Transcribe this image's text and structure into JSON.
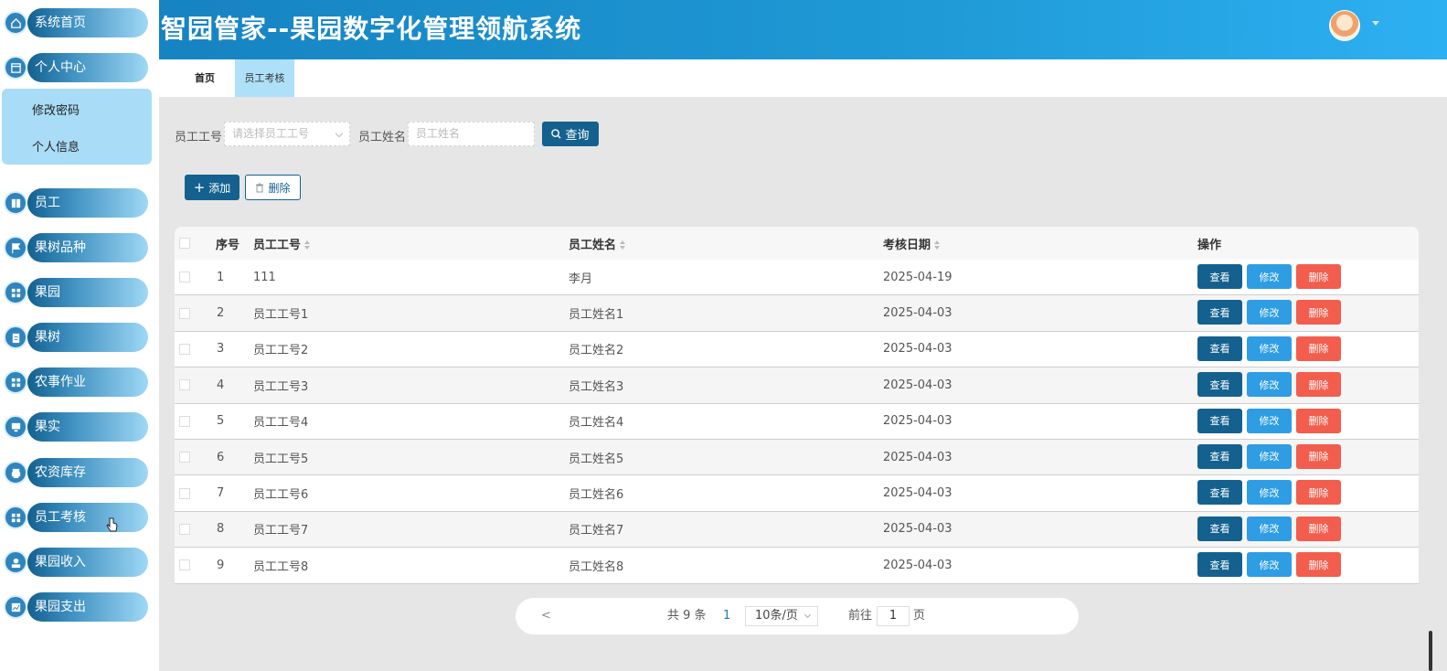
{
  "header": {
    "title": "智园管家--果园数字化管理领航系统"
  },
  "sidebar": {
    "items": [
      {
        "label": "系统首页",
        "icon": "home-icon"
      },
      {
        "label": "个人中心",
        "icon": "window-icon"
      },
      {
        "label": "员工",
        "icon": "book-icon"
      },
      {
        "label": "果树品种",
        "icon": "flag-icon"
      },
      {
        "label": "果园",
        "icon": "grid-icon"
      },
      {
        "label": "果树",
        "icon": "clipboard-icon"
      },
      {
        "label": "农事作业",
        "icon": "grid-icon"
      },
      {
        "label": "果实",
        "icon": "monitor-icon"
      },
      {
        "label": "农资库存",
        "icon": "printer-icon"
      },
      {
        "label": "员工考核",
        "icon": "grid-icon"
      },
      {
        "label": "果园收入",
        "icon": "user-icon"
      },
      {
        "label": "果园支出",
        "icon": "chart-icon"
      }
    ],
    "submenu": [
      "修改密码",
      "个人信息"
    ]
  },
  "tabs": [
    {
      "label": "首页"
    },
    {
      "label": "员工考核"
    }
  ],
  "search": {
    "id_label": "员工工号",
    "id_placeholder": "请选择员工工号",
    "name_label": "员工姓名",
    "name_placeholder": "员工姓名",
    "query_button": "查询"
  },
  "actions": {
    "add": "添加",
    "delete": "删除"
  },
  "table": {
    "headers": [
      "序号",
      "员工工号",
      "员工姓名",
      "考核日期",
      "操作"
    ],
    "op_labels": {
      "view": "查看",
      "edit": "修改",
      "delete": "删除"
    },
    "rows": [
      {
        "no": "1",
        "emp_id": "111",
        "emp_name": "李月",
        "date": "2025-04-19"
      },
      {
        "no": "2",
        "emp_id": "员工工号1",
        "emp_name": "员工姓名1",
        "date": "2025-04-03"
      },
      {
        "no": "3",
        "emp_id": "员工工号2",
        "emp_name": "员工姓名2",
        "date": "2025-04-03"
      },
      {
        "no": "4",
        "emp_id": "员工工号3",
        "emp_name": "员工姓名3",
        "date": "2025-04-03"
      },
      {
        "no": "5",
        "emp_id": "员工工号4",
        "emp_name": "员工姓名4",
        "date": "2025-04-03"
      },
      {
        "no": "6",
        "emp_id": "员工工号5",
        "emp_name": "员工姓名5",
        "date": "2025-04-03"
      },
      {
        "no": "7",
        "emp_id": "员工工号6",
        "emp_name": "员工姓名6",
        "date": "2025-04-03"
      },
      {
        "no": "8",
        "emp_id": "员工工号7",
        "emp_name": "员工姓名7",
        "date": "2025-04-03"
      },
      {
        "no": "9",
        "emp_id": "员工工号8",
        "emp_name": "员工姓名8",
        "date": "2025-04-03"
      }
    ]
  },
  "pagination": {
    "prev": "<",
    "total": "共 9 条",
    "current_page": "1",
    "page_size": "10条/页",
    "goto_prefix": "前往",
    "goto_value": "1",
    "goto_suffix": "页"
  }
}
